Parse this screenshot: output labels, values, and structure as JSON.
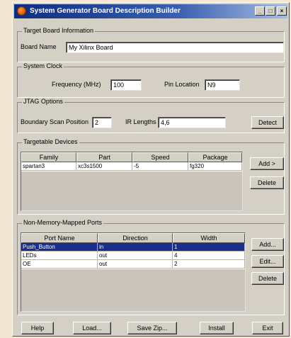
{
  "window": {
    "title": "System Generator Board Description Builder",
    "controls": [
      "_",
      "□",
      "×"
    ]
  },
  "target_board": {
    "group_label": "Target Board Information",
    "board_name_label": "Board Name",
    "board_name_value": "My Xilinx Board"
  },
  "system_clock": {
    "group_label": "System Clock",
    "frequency_label": "Frequency (MHz)",
    "frequency_value": "100",
    "pin_location_label": "Pin Location",
    "pin_location_value": "N9"
  },
  "jtag": {
    "group_label": "JTAG Options",
    "boundary_scan_label": "Boundary Scan Position",
    "boundary_scan_value": "2",
    "ir_lengths_label": "IR Lengths",
    "ir_lengths_value": "4,6",
    "detect_label": "Detect"
  },
  "targetable_devices": {
    "group_label": "Targetable Devices",
    "columns": [
      "Family",
      "Part",
      "Speed",
      "Package"
    ],
    "rows": [
      [
        "spartan3",
        "xc3s1500",
        "-5",
        "fg320"
      ]
    ],
    "add_label": "Add >",
    "delete_label": "Delete"
  },
  "ports": {
    "group_label": "Non-Memory-Mapped Ports",
    "columns": [
      "Port Name",
      "Direction",
      "Width"
    ],
    "rows": [
      [
        "Push_Button",
        "in",
        "1"
      ],
      [
        "LEDs",
        "out",
        "4"
      ],
      [
        "OE",
        "out",
        "2"
      ]
    ],
    "selected_row": 0,
    "add_label": "Add...",
    "edit_label": "Edit...",
    "delete_label": "Delete"
  },
  "footer": {
    "help_label": "Help",
    "load_label": "Load...",
    "save_zip_label": "Save Zip...",
    "install_label": "Install",
    "exit_label": "Exit"
  }
}
